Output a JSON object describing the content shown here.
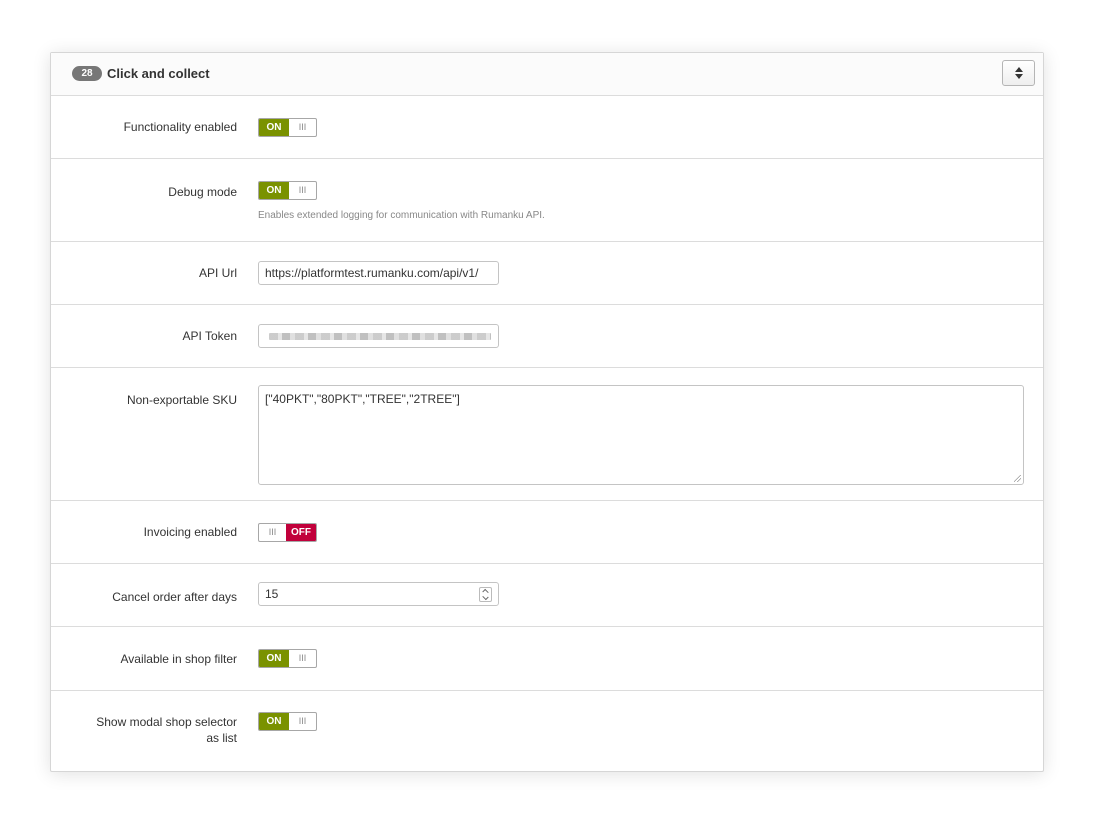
{
  "panel": {
    "badge": "28",
    "title": "Click and collect",
    "collapse_icon": "sort-icon"
  },
  "fields": {
    "functionality": {
      "label": "Functionality enabled",
      "state": "ON",
      "grip": "III"
    },
    "debug": {
      "label": "Debug mode",
      "state": "ON",
      "grip": "III",
      "help": "Enables extended logging for communication with Rumanku API."
    },
    "api_url": {
      "label": "API Url",
      "value": "https://platformtest.rumanku.com/api/v1/"
    },
    "api_token": {
      "label": "API Token"
    },
    "sku": {
      "label": "Non-exportable SKU",
      "value": "[\"40PKT\",\"80PKT\",\"TREE\",\"2TREE\"]"
    },
    "invoicing": {
      "label": "Invoicing enabled",
      "state": "OFF",
      "grip": "III"
    },
    "cancel_days": {
      "label": "Cancel order after days",
      "value": "15"
    },
    "shop_filter": {
      "label": "Available in shop filter",
      "state": "ON",
      "grip": "III"
    },
    "modal_list": {
      "label_line1": "Show modal shop selector",
      "label_line2": "as list",
      "state": "ON",
      "grip": "III"
    }
  },
  "colors": {
    "on": "#7a9200",
    "off": "#c1003b",
    "badge": "#777777"
  }
}
